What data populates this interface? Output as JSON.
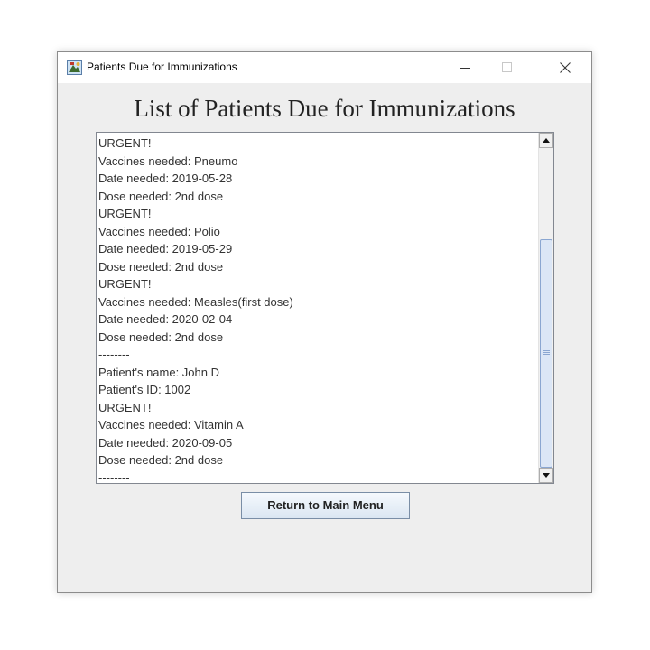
{
  "window": {
    "title": "Patients Due for Immunizations"
  },
  "main": {
    "heading": "List of Patients Due for Immunizations",
    "lines": [
      "URGENT!",
      "Vaccines needed: Pneumo",
      "Date needed: 2019-05-28",
      "Dose needed: 2nd dose",
      "URGENT!",
      "Vaccines needed: Polio",
      "Date needed: 2019-05-29",
      "Dose needed: 2nd dose",
      "URGENT!",
      "Vaccines needed: Measles(first dose)",
      "Date needed: 2020-02-04",
      "Dose needed: 2nd dose",
      "--------",
      "Patient's name: John D",
      "Patient's ID: 1002",
      "URGENT!",
      "Vaccines needed: Vitamin A",
      "Date needed: 2020-09-05",
      "Dose needed: 2nd dose",
      "--------"
    ],
    "scroll": {
      "thumb_start": 0.285,
      "thumb_length": 0.715
    },
    "return_button_label": "Return to Main Menu"
  },
  "icons": {
    "app": "java-app-icon",
    "minimize": "minimize-icon",
    "maximize": "maximize-icon",
    "close": "close-icon",
    "scroll_up": "arrow-up-icon",
    "scroll_down": "arrow-down-icon"
  }
}
